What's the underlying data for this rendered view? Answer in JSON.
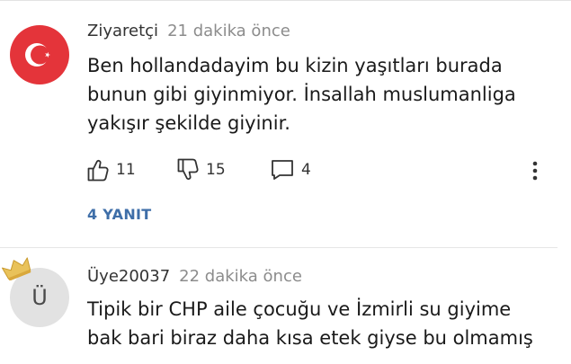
{
  "comments": [
    {
      "user": "Ziyaretçi",
      "time": "21 dakika önce",
      "lines": [
        "Ben hollandadayim bu kizin yaşıtları burada",
        "bunun gibi giyinmiyor. İnsallah muslumanliga",
        "yakışır şekilde giyinir."
      ],
      "avatar_icon": "turkish-flag-icon",
      "likes": "11",
      "dislikes": "15",
      "reply_count": "4",
      "replies_label": "4 YANIT"
    },
    {
      "user": "Üye20037",
      "time": "22 dakika önce",
      "avatar_letter": "Ü",
      "avatar_badge_icon": "crown-icon",
      "lines": [
        "Tipik bir CHP aile çocuğu ve İzmirli su giyime",
        "bak bari biraz daha kısa etek giyse bu olmamış"
      ]
    }
  ],
  "colors": {
    "flag_red": "#e4343a",
    "link_blue": "#3e6ea8",
    "crown_gold": "#e9c25a",
    "muted_text": "#8c8c8c"
  }
}
